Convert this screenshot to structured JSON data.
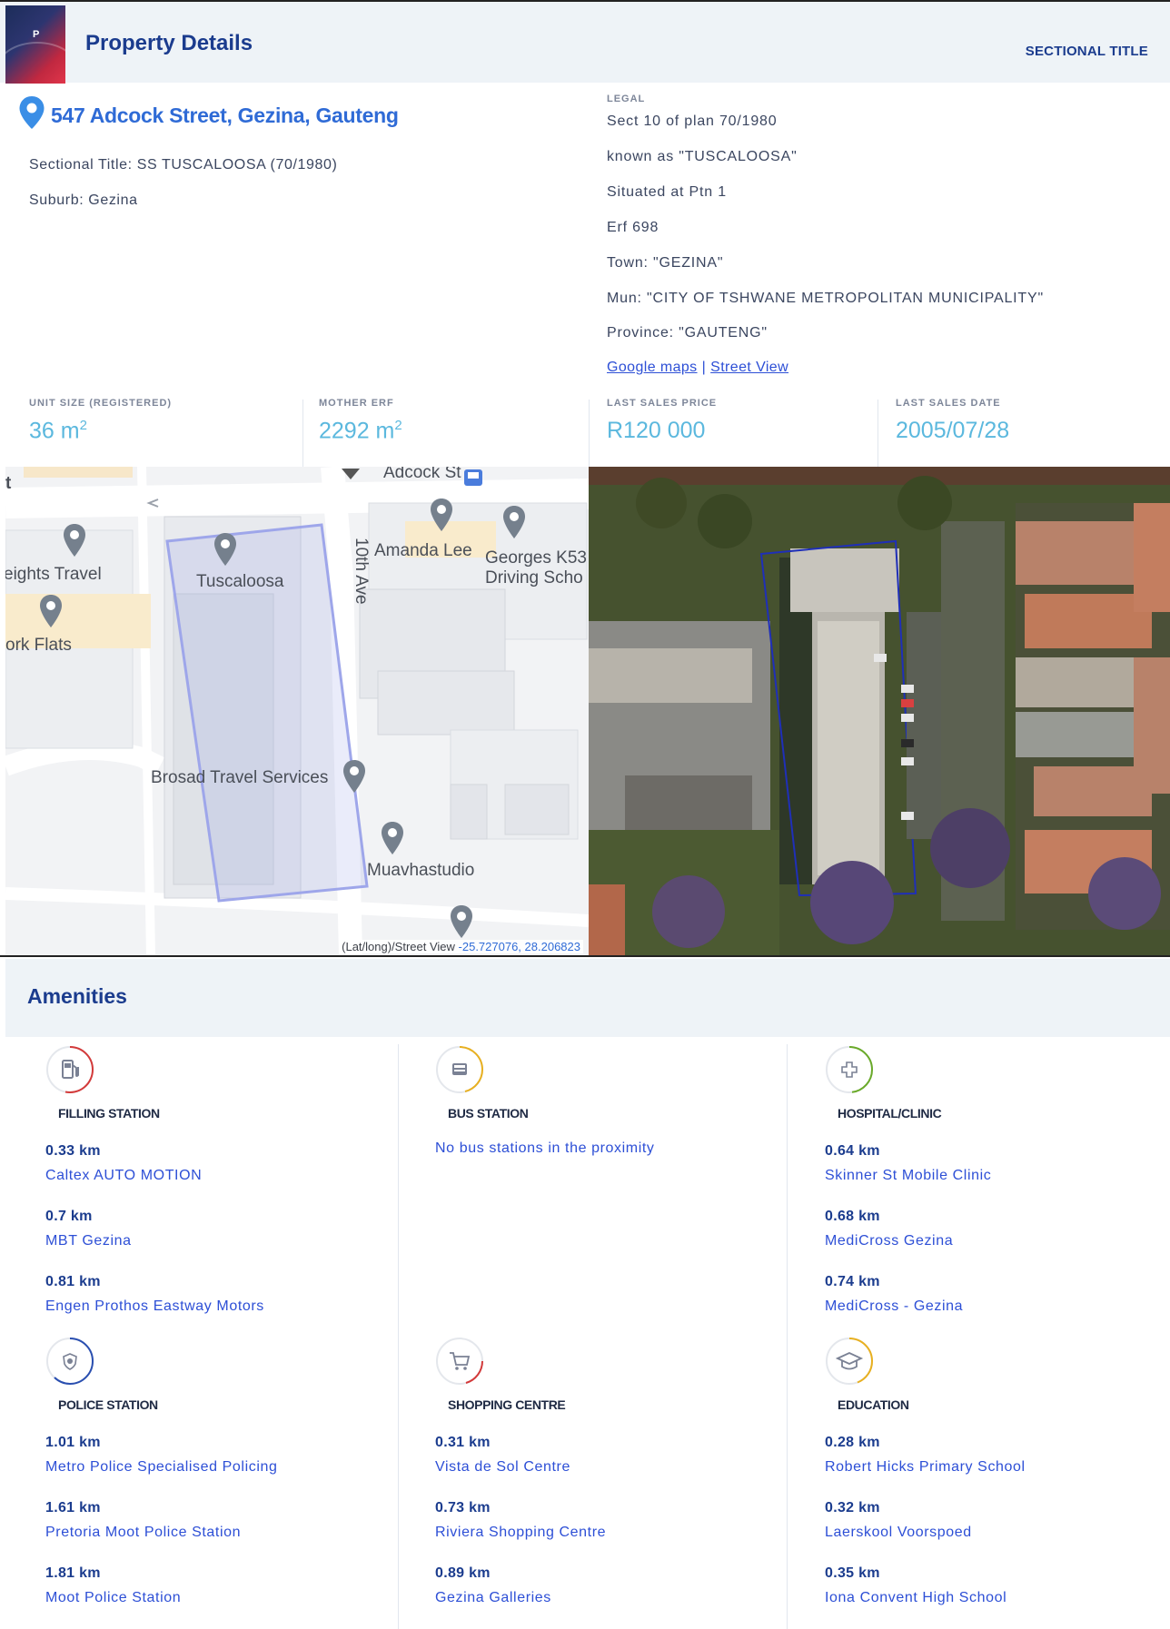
{
  "header": {
    "title": "Property Details",
    "property_type": "SECTIONAL TITLE",
    "logo_letter": "P"
  },
  "address": "547 Adcock Street, Gezina, Gauteng",
  "sectional_title": "Sectional Title: SS TUSCALOOSA (70/1980)",
  "suburb": "Suburb: Gezina",
  "legal": {
    "label": "LEGAL",
    "lines": [
      "Sect 10 of plan 70/1980",
      "known as \"TUSCALOOSA\"",
      "Situated at Ptn 1",
      "Erf 698",
      "Town: \"GEZINA\"",
      "Mun: \"CITY OF TSHWANE METROPOLITAN MUNICIPALITY\"",
      "Province: \"GAUTENG\""
    ],
    "google_maps": "Google maps",
    "separator": "|",
    "street_view": "Street View"
  },
  "stats": [
    {
      "label": "UNIT SIZE (REGISTERED)",
      "value": "36 m",
      "sup": "2"
    },
    {
      "label": "MOTHER ERF",
      "value": "2292 m",
      "sup": "2"
    },
    {
      "label": "LAST SALES PRICE",
      "value": "R120 000",
      "sup": ""
    },
    {
      "label": "LAST SALES DATE",
      "value": "2005/07/28",
      "sup": ""
    }
  ],
  "map": {
    "labels": {
      "adcock": "Adcock St",
      "tenth_ave": "10th Ave",
      "amanda": "Amanda Lee",
      "georges": "Georges K53",
      "driving": "Driving Scho",
      "heights": "eights Travel",
      "tuscaloosa": "Tuscaloosa",
      "york": "ork Flats",
      "brosad": "Brosad Travel Services",
      "muav": "Muavhastudio",
      "street_t": "t"
    },
    "caption_prefix": "(Lat/long)/Street View ",
    "caption_coords": "-25.727076, 28.206823"
  },
  "amenities": {
    "title": "Amenities",
    "categories": [
      {
        "name": "FILLING STATION",
        "icon": "fuel-icon",
        "ring": "#d33a3a",
        "items": [
          {
            "km": "0.33 km",
            "name": "Caltex AUTO MOTION"
          },
          {
            "km": "0.7 km",
            "name": "MBT Gezina"
          },
          {
            "km": "0.81 km",
            "name": "Engen Prothos Eastway Motors"
          }
        ]
      },
      {
        "name": "BUS STATION",
        "icon": "bus-icon",
        "ring": "#e8b020",
        "empty": "No bus stations in the proximity",
        "items": []
      },
      {
        "name": "HOSPITAL/CLINIC",
        "icon": "medical-cross-icon",
        "ring": "#6aaa2a",
        "items": [
          {
            "km": "0.64 km",
            "name": "Skinner St Mobile Clinic"
          },
          {
            "km": "0.68 km",
            "name": "MediCross Gezina"
          },
          {
            "km": "0.74 km",
            "name": "MediCross - Gezina"
          }
        ]
      },
      {
        "name": "POLICE STATION",
        "icon": "police-badge-icon",
        "ring": "#2a4fb0",
        "items": [
          {
            "km": "1.01 km",
            "name": "Metro Police Specialised Policing"
          },
          {
            "km": "1.61 km",
            "name": "Pretoria Moot Police Station"
          },
          {
            "km": "1.81 km",
            "name": "Moot Police Station"
          }
        ]
      },
      {
        "name": "SHOPPING CENTRE",
        "icon": "shopping-cart-icon",
        "ring": "#d33a3a",
        "items": [
          {
            "km": "0.31 km",
            "name": "Vista de Sol Centre"
          },
          {
            "km": "0.73 km",
            "name": "Riviera Shopping Centre"
          },
          {
            "km": "0.89 km",
            "name": "Gezina Galleries"
          }
        ]
      },
      {
        "name": "EDUCATION",
        "icon": "graduation-cap-icon",
        "ring": "#e8b020",
        "items": [
          {
            "km": "0.28 km",
            "name": "Robert Hicks Primary School"
          },
          {
            "km": "0.32 km",
            "name": "Laerskool Voorspoed"
          },
          {
            "km": "0.35 km",
            "name": "Iona Convent High School"
          }
        ]
      }
    ]
  }
}
